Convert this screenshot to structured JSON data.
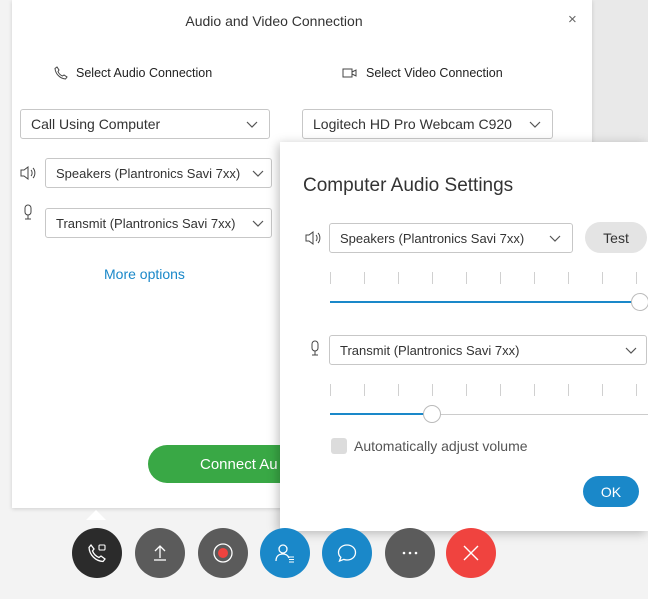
{
  "dialog": {
    "title": "Audio and Video Connection",
    "close": "×",
    "audio_heading": "Select Audio Connection",
    "video_heading": "Select Video Connection",
    "audio_connection": "Call Using Computer",
    "video_device": "Logitech HD Pro Webcam C920",
    "speaker_device": "Speakers (Plantronics Savi 7xx)",
    "mic_device": "Transmit (Plantronics Savi 7xx)",
    "more_options": "More options",
    "connect_button": "Connect Au"
  },
  "computer_audio_settings": {
    "title": "Computer Audio Settings",
    "speaker_device": "Speakers (Plantronics Savi 7xx)",
    "test_button": "Test",
    "speaker_volume_fraction": 1.0,
    "mic_device": "Transmit (Plantronics Savi 7xx)",
    "mic_volume_fraction": 0.33,
    "auto_adjust_label": "Automatically adjust volume",
    "auto_adjust_checked": false,
    "ok_button": "OK"
  },
  "toolbar": {
    "buttons": [
      {
        "name": "audio-connection",
        "icon": "phone-icon",
        "color": "#2b2b2b"
      },
      {
        "name": "share",
        "icon": "upload-icon",
        "color": "#5b5b5b"
      },
      {
        "name": "record",
        "icon": "record-icon",
        "color": "#5b5b5b"
      },
      {
        "name": "participants",
        "icon": "participants-icon",
        "color": "#1a88c9"
      },
      {
        "name": "chat",
        "icon": "chat-bubble-icon",
        "color": "#1a88c9"
      },
      {
        "name": "more",
        "icon": "ellipsis-icon",
        "color": "#5b5b5b"
      },
      {
        "name": "leave",
        "icon": "close-icon",
        "color": "#f0433f"
      }
    ]
  },
  "colors": {
    "accent": "#1a88c9",
    "connect": "#39a845",
    "leave": "#f0433f"
  }
}
